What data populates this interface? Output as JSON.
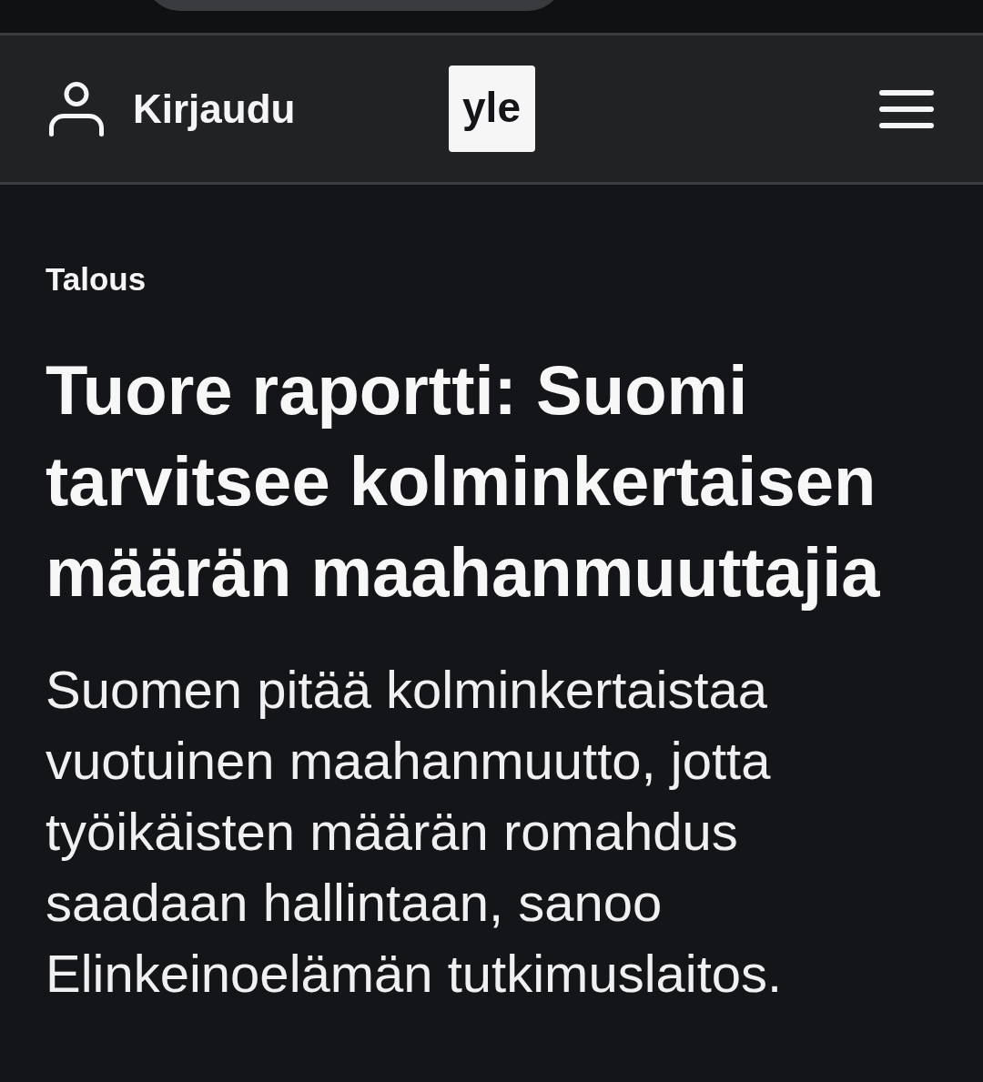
{
  "header": {
    "login": {
      "label": "Kirjaudu"
    },
    "logo": {
      "text": "yle"
    }
  },
  "article": {
    "section": "Talous",
    "headline": "Tuore raportti: Suomi tarvitsee kolminkertaisen määrän maahanmuuttajia",
    "lead": "Suomen pitää kolminkertaistaa vuotuinen maahanmuutto, jotta työikäisten määrän romahdus saadaan hallintaan, sanoo Elinkeinoelämän tutkimuslaitos."
  }
}
